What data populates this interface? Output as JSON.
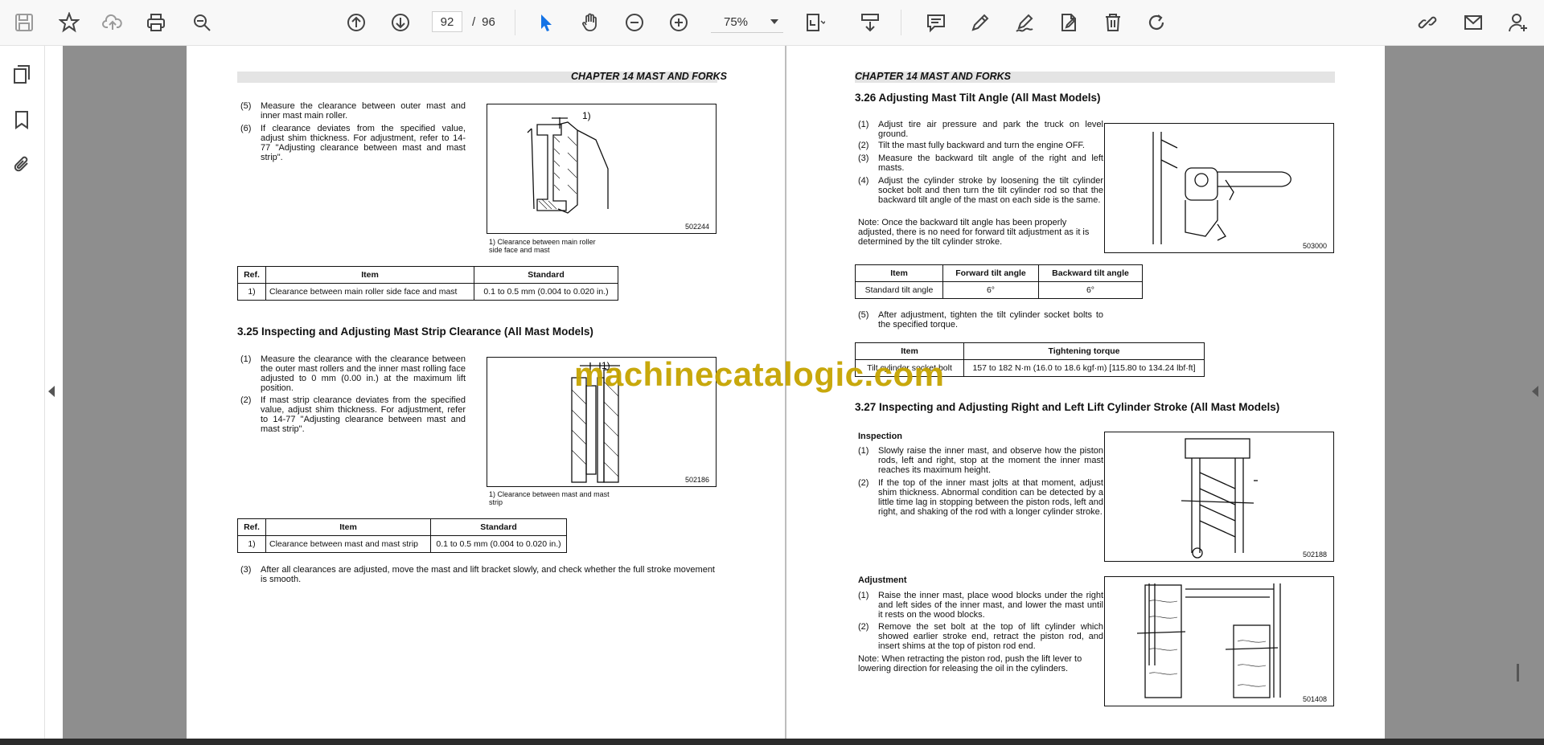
{
  "toolbar": {
    "page_current": "92",
    "page_separator": "/",
    "page_total": "96",
    "zoom": "75%"
  },
  "header": {
    "left": "CHAPTER 14 MAST AND FORKS",
    "right": "CHAPTER 14 MAST AND FORKS"
  },
  "left_page": {
    "items_top": [
      {
        "num": "(5)",
        "text": "Measure the clearance between outer mast and inner mast main roller."
      },
      {
        "num": "(6)",
        "text": "If clearance deviates from the specified value, adjust shim thickness. For adjustment, refer to 14-77 \"Adjusting clearance between mast and mast strip\"."
      }
    ],
    "fig1": {
      "label": "1)",
      "code": "502244",
      "caption": "1) Clearance between main roller side face and mast"
    },
    "table1": {
      "headers": [
        "Ref.",
        "Item",
        "Standard"
      ],
      "rows": [
        [
          "1)",
          "Clearance between main roller side face and mast",
          "0.1 to 0.5 mm (0.004 to 0.020 in.)"
        ]
      ]
    },
    "section_325": "3.25    Inspecting and Adjusting Mast Strip Clearance (All Mast Models)",
    "items_325": [
      {
        "num": "(1)",
        "text": "Measure the clearance with the clearance between the outer mast rollers and the inner mast rolling face adjusted to 0 mm (0.00 in.) at the maximum lift position."
      },
      {
        "num": "(2)",
        "text": "If mast strip clearance deviates from the specified value, adjust shim thickness. For adjustment, refer to 14-77 \"Adjusting clearance between mast and mast strip\"."
      }
    ],
    "fig2": {
      "label": "1)",
      "code": "502186",
      "caption": "1) Clearance between mast and mast strip"
    },
    "table2": {
      "headers": [
        "Ref.",
        "Item",
        "Standard"
      ],
      "rows": [
        [
          "1)",
          "Clearance between mast and mast strip",
          "0.1 to 0.5 mm (0.004 to 0.020 in.)"
        ]
      ]
    },
    "item_3": {
      "num": "(3)",
      "text": "After all clearances are adjusted, move the mast and lift bracket slowly, and check whether the full stroke movement is smooth."
    }
  },
  "right_page": {
    "section_326": "3.26    Adjusting Mast Tilt Angle (All Mast Models)",
    "items_326": [
      {
        "num": "(1)",
        "text": "Adjust tire air pressure and park the truck on level ground."
      },
      {
        "num": "(2)",
        "text": "Tilt the mast fully backward and turn the engine OFF."
      },
      {
        "num": "(3)",
        "text": "Measure the backward tilt angle of the right and left masts."
      },
      {
        "num": "(4)",
        "text": "Adjust the cylinder stroke by loosening the tilt cylinder socket bolt and then turn the tilt cylinder rod so that the backward tilt angle of the mast on each side is the same."
      }
    ],
    "note_326": "Note: Once the backward tilt angle has been properly adjusted, there is no need for forward tilt adjustment as it is determined by the tilt cylinder stroke.",
    "fig3": {
      "code": "503000"
    },
    "table3": {
      "headers": [
        "Item",
        "Forward tilt angle",
        "Backward tilt angle"
      ],
      "rows": [
        [
          "Standard tilt angle",
          "6°",
          "6°"
        ]
      ]
    },
    "item_5": {
      "num": "(5)",
      "text": "After adjustment, tighten the tilt cylinder socket bolts to the specified torque."
    },
    "table4": {
      "headers": [
        "Item",
        "Tightening torque"
      ],
      "rows": [
        [
          "Tilt cylinder socket bolt",
          "157 to 182 N·m (16.0 to 18.6 kgf·m) [115.80 to 134.24 lbf·ft]"
        ]
      ]
    },
    "section_327": "3.27    Inspecting and Adjusting Right and Left Lift Cylinder Stroke (All Mast Models)",
    "inspection_title": "Inspection",
    "items_inspection": [
      {
        "num": "(1)",
        "text": "Slowly raise the inner mast, and observe how the piston rods, left and right, stop at the moment the inner mast reaches its maximum height."
      },
      {
        "num": "(2)",
        "text": "If the top of the inner mast jolts at that moment, adjust shim thickness. Abnormal condition can be detected by a little time lag in stopping between the piston rods, left and right, and shaking of the rod with a longer cylinder stroke."
      }
    ],
    "fig4": {
      "code": "502188"
    },
    "adjustment_title": "Adjustment",
    "items_adjustment": [
      {
        "num": "(1)",
        "text": "Raise the inner mast, place wood blocks under the right and left sides of the inner mast, and lower the mast until it rests on the wood blocks."
      },
      {
        "num": "(2)",
        "text": "Remove the set bolt at the top of lift cylinder which showed earlier stroke end, retract the piston rod, and insert shims at the top of piston rod end."
      }
    ],
    "note_adjustment": "Note: When retracting the piston rod, push the lift lever to lowering direction for releasing the oil in the cylinders.",
    "fig5": {
      "code": "501408"
    }
  },
  "watermark": "machinecatalogic.com",
  "icons": {
    "toolbar": [
      "save-icon",
      "star-icon",
      "cloud-upload-icon",
      "print-icon",
      "zoom-search-icon",
      "page-up-icon",
      "page-down-icon",
      "select-cursor-icon",
      "hand-icon",
      "zoom-out-icon",
      "zoom-in-icon",
      "fit-page-icon",
      "scroll-mode-icon",
      "comment-icon",
      "pen-icon",
      "sign-icon",
      "edit-pdf-icon",
      "delete-icon",
      "redo-icon",
      "share-link-icon",
      "email-icon",
      "account-icon"
    ],
    "sidebar": [
      "thumbnails-icon",
      "bookmark-icon",
      "attachment-icon"
    ]
  },
  "colors": {
    "watermark": "#c6a400",
    "accent": "#1473e6",
    "doc_background": "#8e8e8e"
  }
}
